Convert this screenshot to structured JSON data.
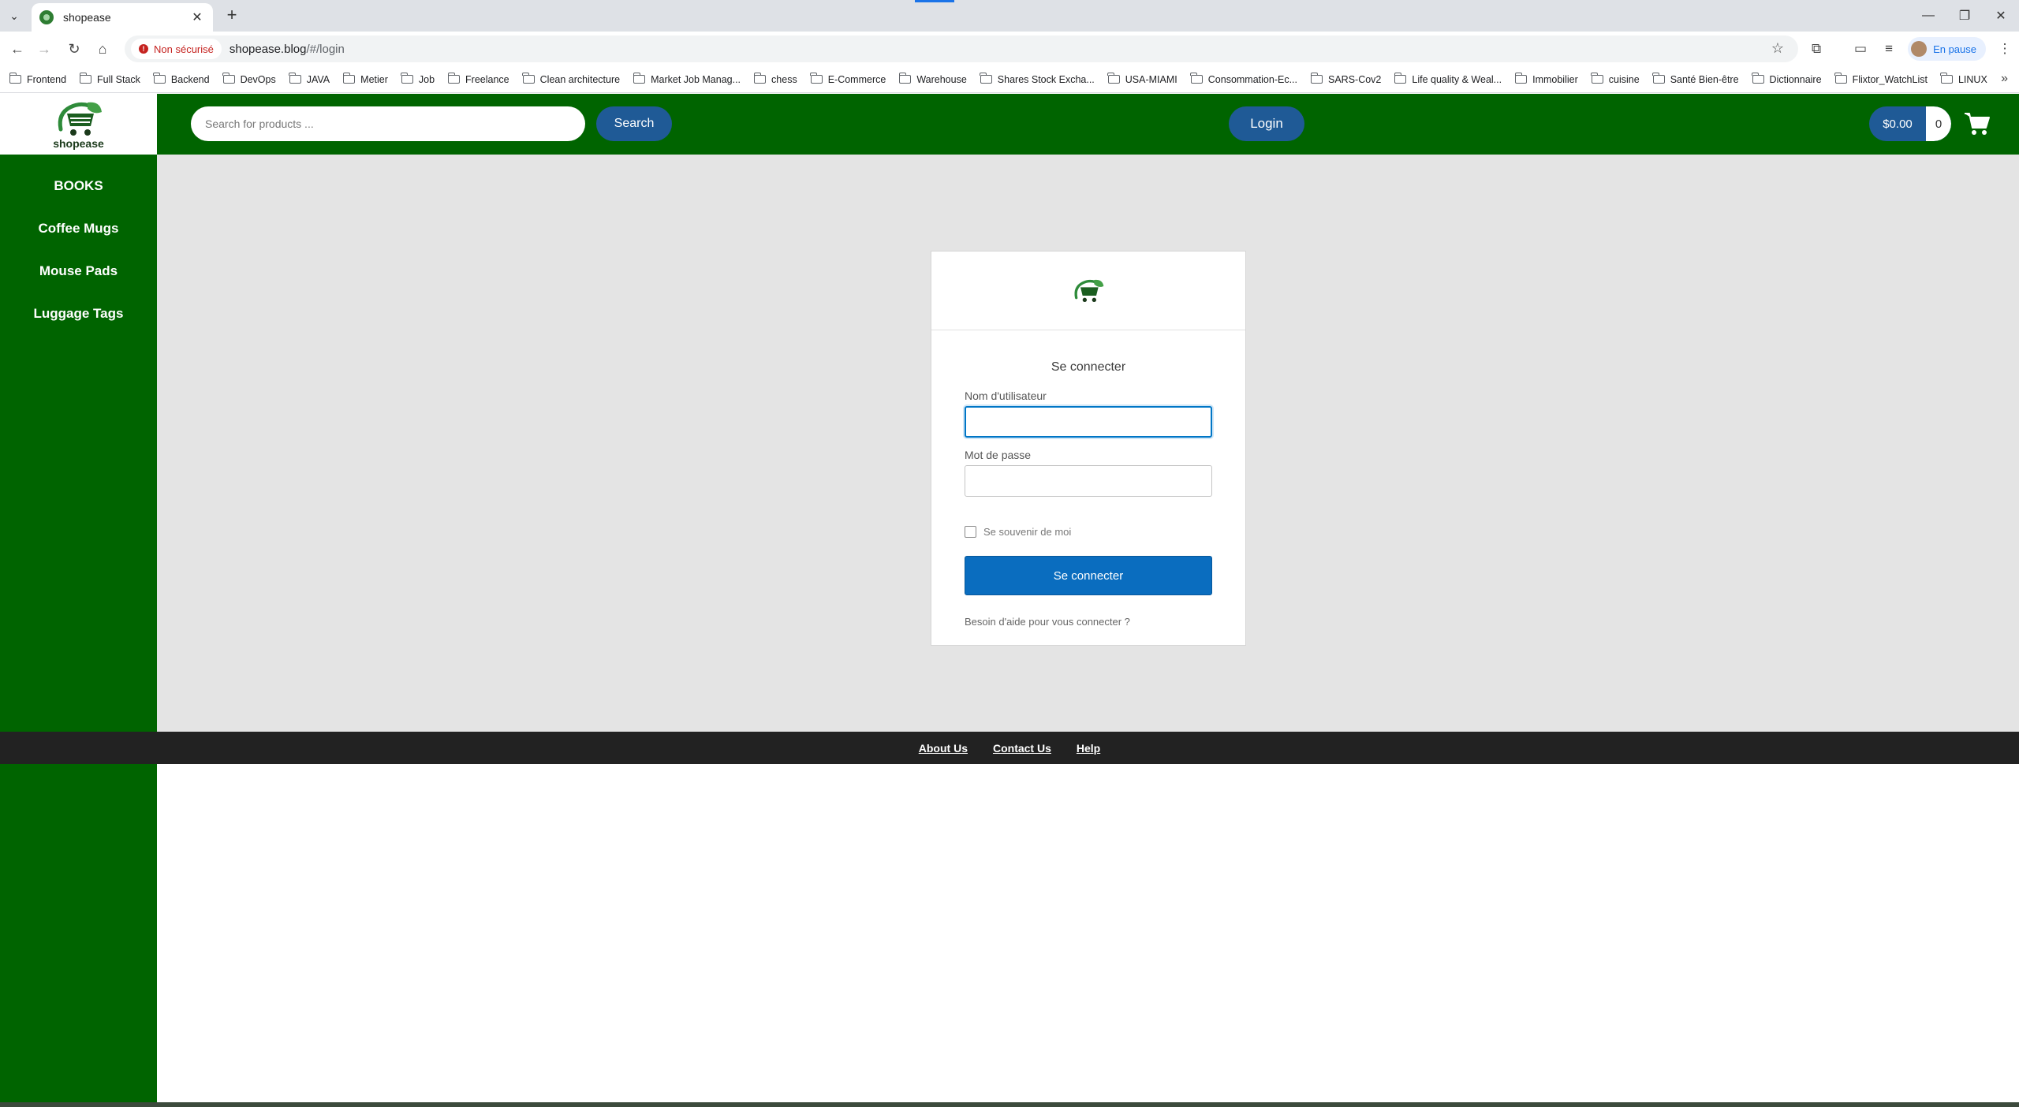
{
  "browser": {
    "tab": {
      "title": "shopease"
    },
    "address": {
      "security_label": "Non sécurisé",
      "url_host": "shopease.blog",
      "url_path": "/#/login"
    },
    "profile": {
      "status": "En pause"
    },
    "bookmarks": [
      "Frontend",
      "Full Stack",
      "Backend",
      "DevOps",
      "JAVA",
      "Metier",
      "Job",
      "Freelance",
      "Clean architecture",
      "Market Job Manag...",
      "chess",
      "E-Commerce",
      "Warehouse",
      "Shares Stock Excha...",
      "USA-MIAMI",
      "Consommation-Ec...",
      "SARS-Cov2",
      "Life quality & Weal...",
      "Immobilier",
      "cuisine",
      "Santé Bien-être",
      "Dictionnaire",
      "Flixtor_WatchList",
      "LINUX"
    ]
  },
  "header": {
    "brand": "shopease",
    "search": {
      "placeholder": "Search for products ..."
    },
    "search_label": "Search",
    "login_label": "Login",
    "cart": {
      "total": "$0.00",
      "count": "0"
    }
  },
  "sidebar": {
    "items": [
      {
        "label": "BOOKS"
      },
      {
        "label": "Coffee Mugs"
      },
      {
        "label": "Mouse Pads"
      },
      {
        "label": "Luggage Tags"
      }
    ]
  },
  "login_form": {
    "heading": "Se connecter",
    "username_label": "Nom d'utilisateur",
    "username_value": "",
    "password_label": "Mot de passe",
    "password_value": "",
    "remember_label": "Se souvenir de moi",
    "remember_checked": false,
    "submit_label": "Se connecter",
    "help_link": "Besoin d'aide pour vous connecter ?"
  },
  "footer": {
    "links": [
      "About Us",
      "Contact Us",
      "Help"
    ]
  },
  "colors": {
    "brand_green": "#006400",
    "pill_blue": "#1f5a96",
    "submit_blue": "#0a6dbf",
    "footer_dark": "#222222",
    "content_gray": "#e4e4e4"
  }
}
